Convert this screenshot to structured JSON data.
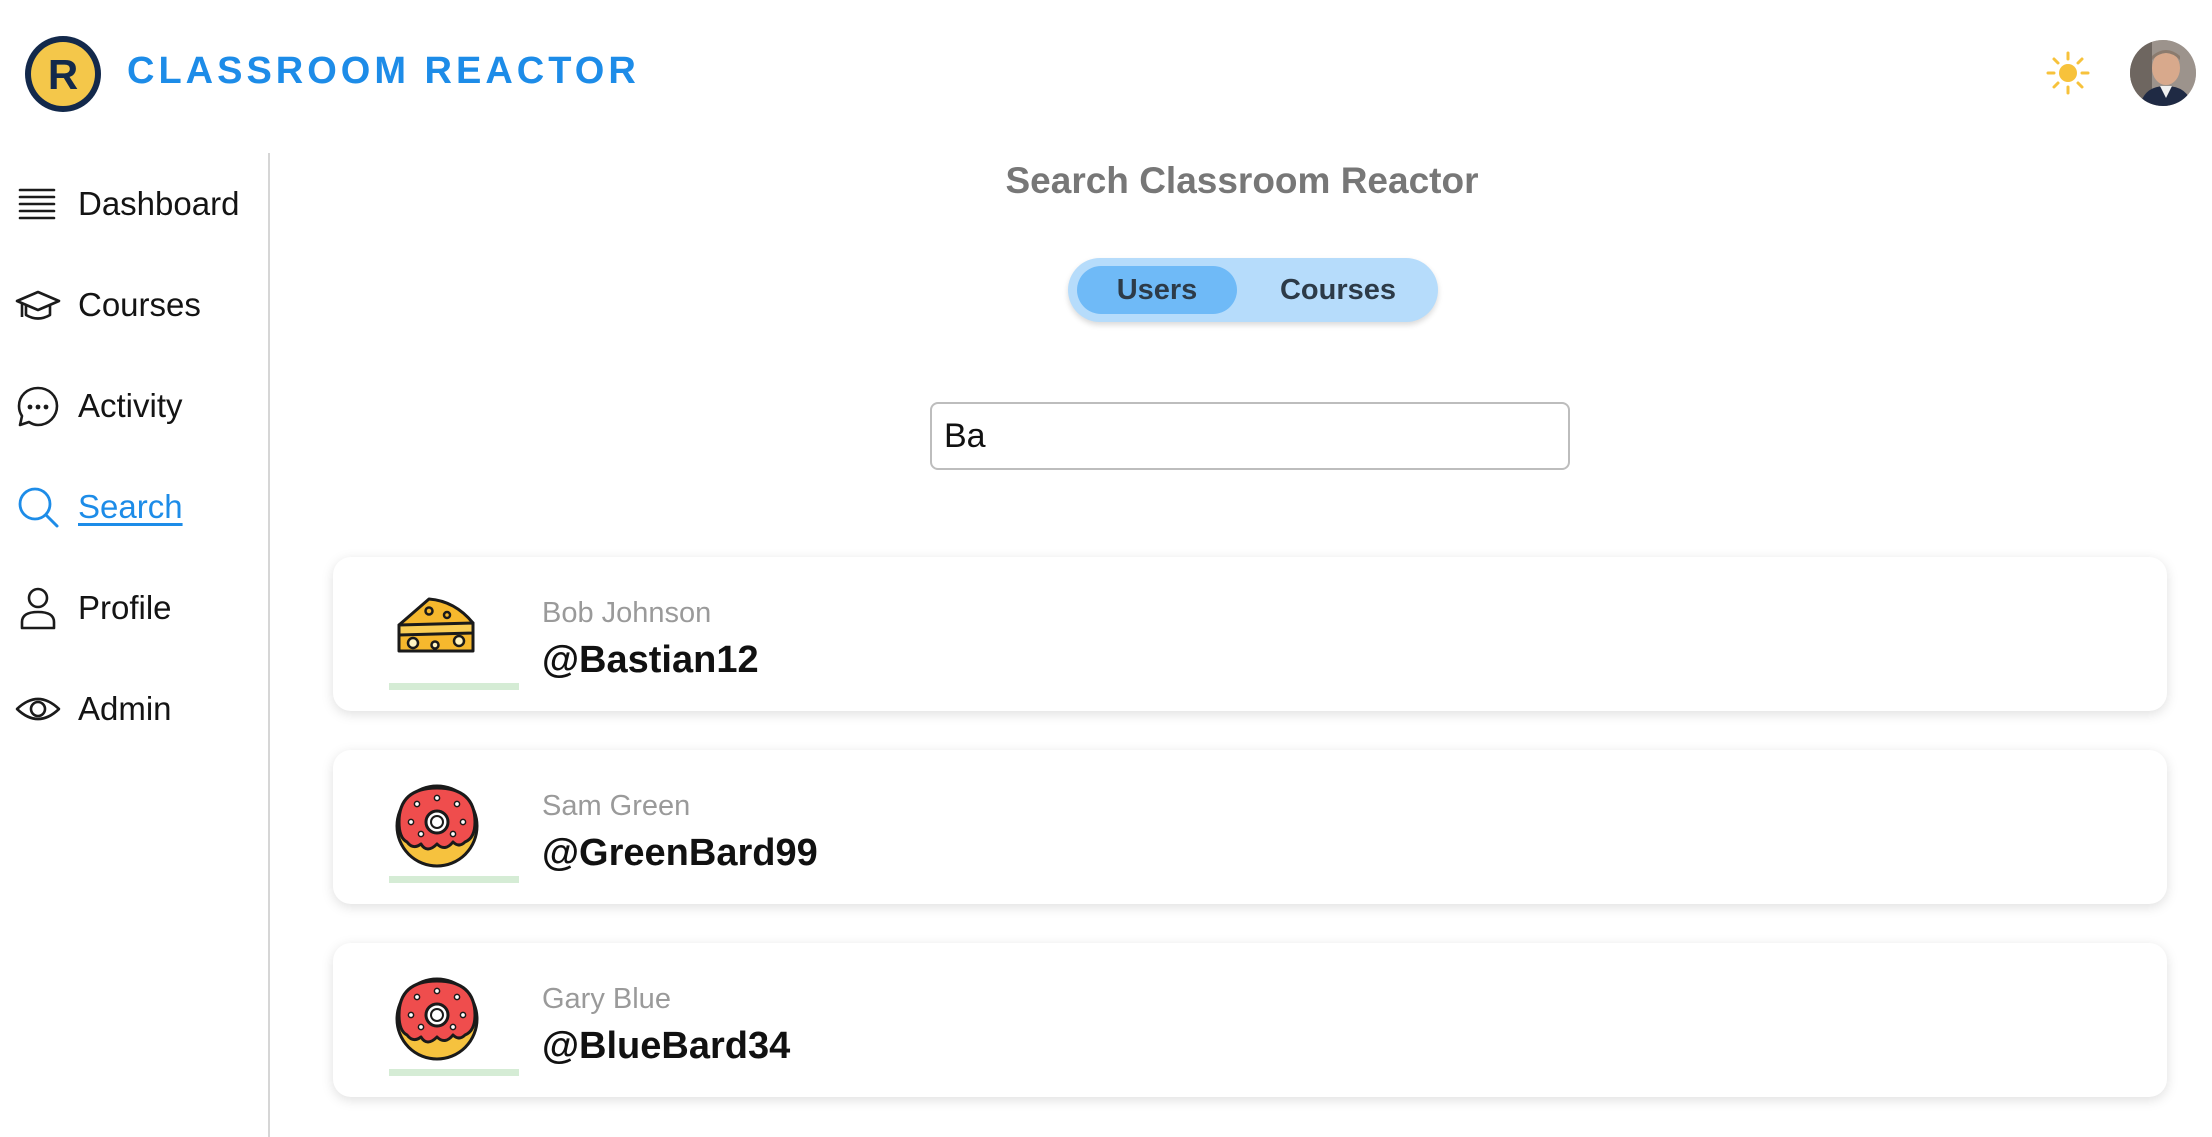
{
  "app": {
    "logo_letter": "R",
    "brand": "CLASSROOM REACTOR",
    "brand_color": "#1d8ce8",
    "theme_icon": "sun-icon",
    "accent_yellow": "#f4c74a"
  },
  "sidebar": {
    "items": [
      {
        "label": "Dashboard",
        "icon": "list-icon",
        "active": false
      },
      {
        "label": "Courses",
        "icon": "graduation-cap-icon",
        "active": false
      },
      {
        "label": "Activity",
        "icon": "chat-bubble-icon",
        "active": false
      },
      {
        "label": "Search",
        "icon": "search-icon",
        "active": true
      },
      {
        "label": "Profile",
        "icon": "person-icon",
        "active": false
      },
      {
        "label": "Admin",
        "icon": "eye-icon",
        "active": false
      }
    ]
  },
  "main": {
    "title": "Search Classroom Reactor",
    "tabs": [
      {
        "label": "Users",
        "selected": true
      },
      {
        "label": "Courses",
        "selected": false
      }
    ],
    "search_value": "Ba",
    "results": [
      {
        "name": "Bob Johnson",
        "handle": "@Bastian12",
        "icon": "cheese-icon"
      },
      {
        "name": "Sam Green",
        "handle": "@GreenBard99",
        "icon": "donut-icon"
      },
      {
        "name": "Gary Blue",
        "handle": "@BlueBard34",
        "icon": "donut-icon"
      }
    ]
  }
}
